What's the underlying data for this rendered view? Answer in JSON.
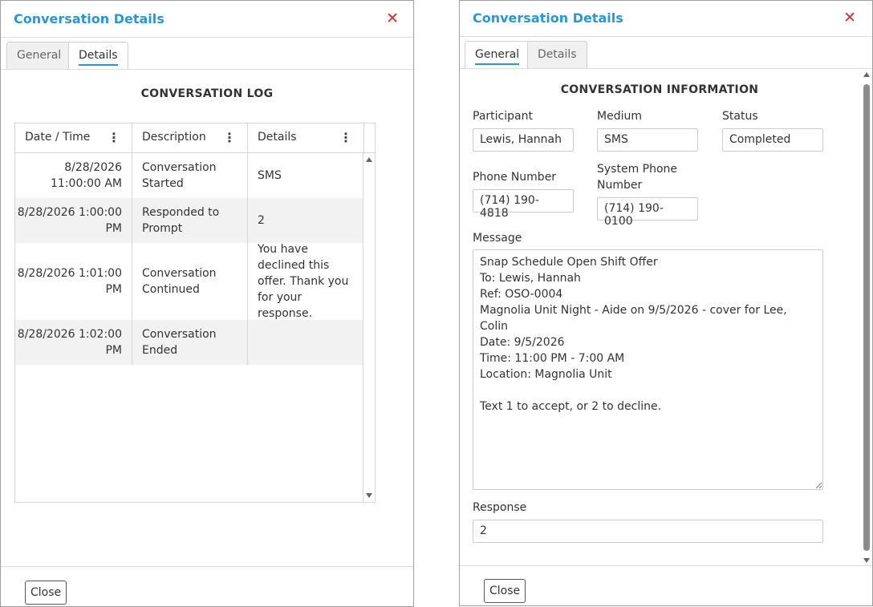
{
  "left_dialog": {
    "title": "Conversation Details",
    "close_glyph": "✕",
    "tabs": [
      {
        "label": "General",
        "active": false
      },
      {
        "label": "Details",
        "active": true
      }
    ],
    "heading": "CONVERSATION LOG",
    "columns": [
      "Date / Time",
      "Description",
      "Details"
    ],
    "rows": [
      {
        "datetime": "8/28/2026 11:00:00 AM",
        "description": "Conversation Started",
        "details": "SMS"
      },
      {
        "datetime": "8/28/2026 1:00:00 PM",
        "description": "Responded to Prompt",
        "details": "2"
      },
      {
        "datetime": "8/28/2026 1:01:00 PM",
        "description": "Conversation Continued",
        "details": "You have declined this offer. Thank you for your response."
      },
      {
        "datetime": "8/28/2026 1:02:00 PM",
        "description": "Conversation Ended",
        "details": ""
      }
    ],
    "close_button": "Close"
  },
  "right_dialog": {
    "title": "Conversation Details",
    "close_glyph": "✕",
    "tabs": [
      {
        "label": "General",
        "active": true
      },
      {
        "label": "Details",
        "active": false
      }
    ],
    "heading": "CONVERSATION INFORMATION",
    "participant": {
      "label": "Participant",
      "value": "Lewis, Hannah"
    },
    "medium": {
      "label": "Medium",
      "value": "SMS"
    },
    "status": {
      "label": "Status",
      "value": "Completed"
    },
    "phone_number": {
      "label": "Phone Number",
      "value": "(714) 190-4818"
    },
    "system_phone": {
      "label": "System Phone Number",
      "value": "(714) 190-0100"
    },
    "message": {
      "label": "Message",
      "value": "Snap Schedule Open Shift Offer\nTo: Lewis, Hannah\nRef: OSO-0004\nMagnolia Unit Night - Aide on 9/5/2026 - cover for Lee, Colin\nDate: 9/5/2026\nTime: 11:00 PM - 7:00 AM\nLocation: Magnolia Unit\n\nText 1 to accept, or 2 to decline."
    },
    "response": {
      "label": "Response",
      "value": "2"
    },
    "close_button": "Close"
  },
  "colors": {
    "title": "#2a96d4",
    "close_x": "#d03030",
    "alt_row": "#f2f2f2"
  }
}
